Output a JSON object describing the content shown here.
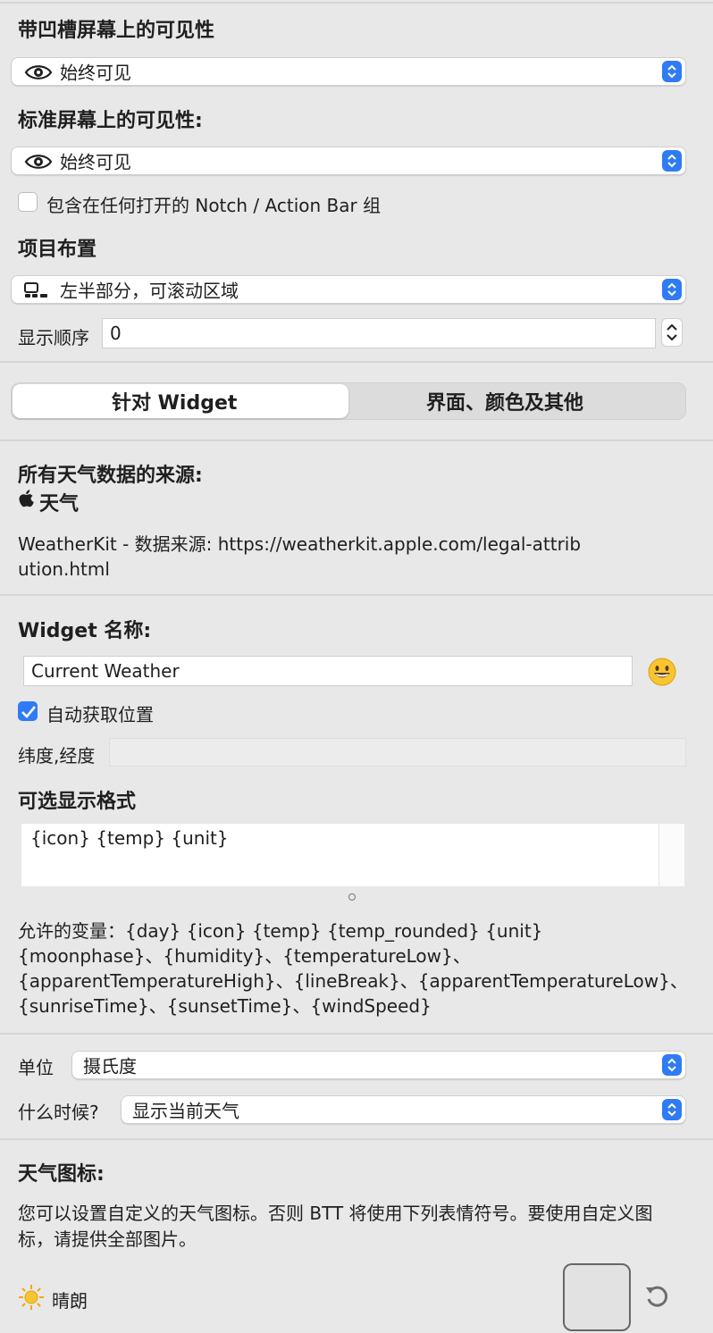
{
  "visibility": {
    "notch_heading": "带凹槽屏幕上的可见性",
    "notch_value": "始终可见",
    "standard_heading": "标准屏幕上的可见性:",
    "standard_value": "始终可见",
    "include_checkbox_label": "包含在任何打开的 Notch / Action Bar 组",
    "include_checked": false
  },
  "placement": {
    "heading": "项目布置",
    "value": "左半部分，可滚动区域",
    "order_label": "显示顺序",
    "order_value": "0"
  },
  "tabs": [
    {
      "label": "针对 Widget",
      "active": true
    },
    {
      "label": "界面、颜色及其他",
      "active": false
    }
  ],
  "source": {
    "heading": "所有天气数据的来源:",
    "provider": "天气",
    "attribution": "WeatherKit - 数据来源: https://weatherkit.apple.com/legal-attribution.html"
  },
  "widget": {
    "name_heading": "Widget 名称:",
    "name_value": "Current Weather",
    "auto_location_label": "自动获取位置",
    "auto_location_checked": true,
    "latlon_label": "纬度,经度",
    "latlon_value": "",
    "format_heading": "可选显示格式",
    "format_value": "{icon} {temp} {unit}",
    "variables_text": "允许的变量：{day} {icon} {temp} {temp_rounded} {unit} {moonphase}、{humidity}、{temperatureLow}、{apparentTemperatureHigh}、{lineBreak}、{apparentTemperatureLow}、{sunriseTime}、{sunsetTime}、{windSpeed}"
  },
  "units": {
    "unit_label": "单位",
    "unit_value": "摄氏度",
    "when_label": "什么时候?",
    "when_value": "显示当前天气"
  },
  "icons": {
    "heading": "天气图标:",
    "description": "您可以设置自定义的天气图标。否则 BTT 将使用下列表情符号。要使用自定义图标，请提供全部图片。",
    "row_label": "晴朗"
  },
  "colors": {
    "accent": "#2f7bf5",
    "background": "#e8e8e8"
  }
}
